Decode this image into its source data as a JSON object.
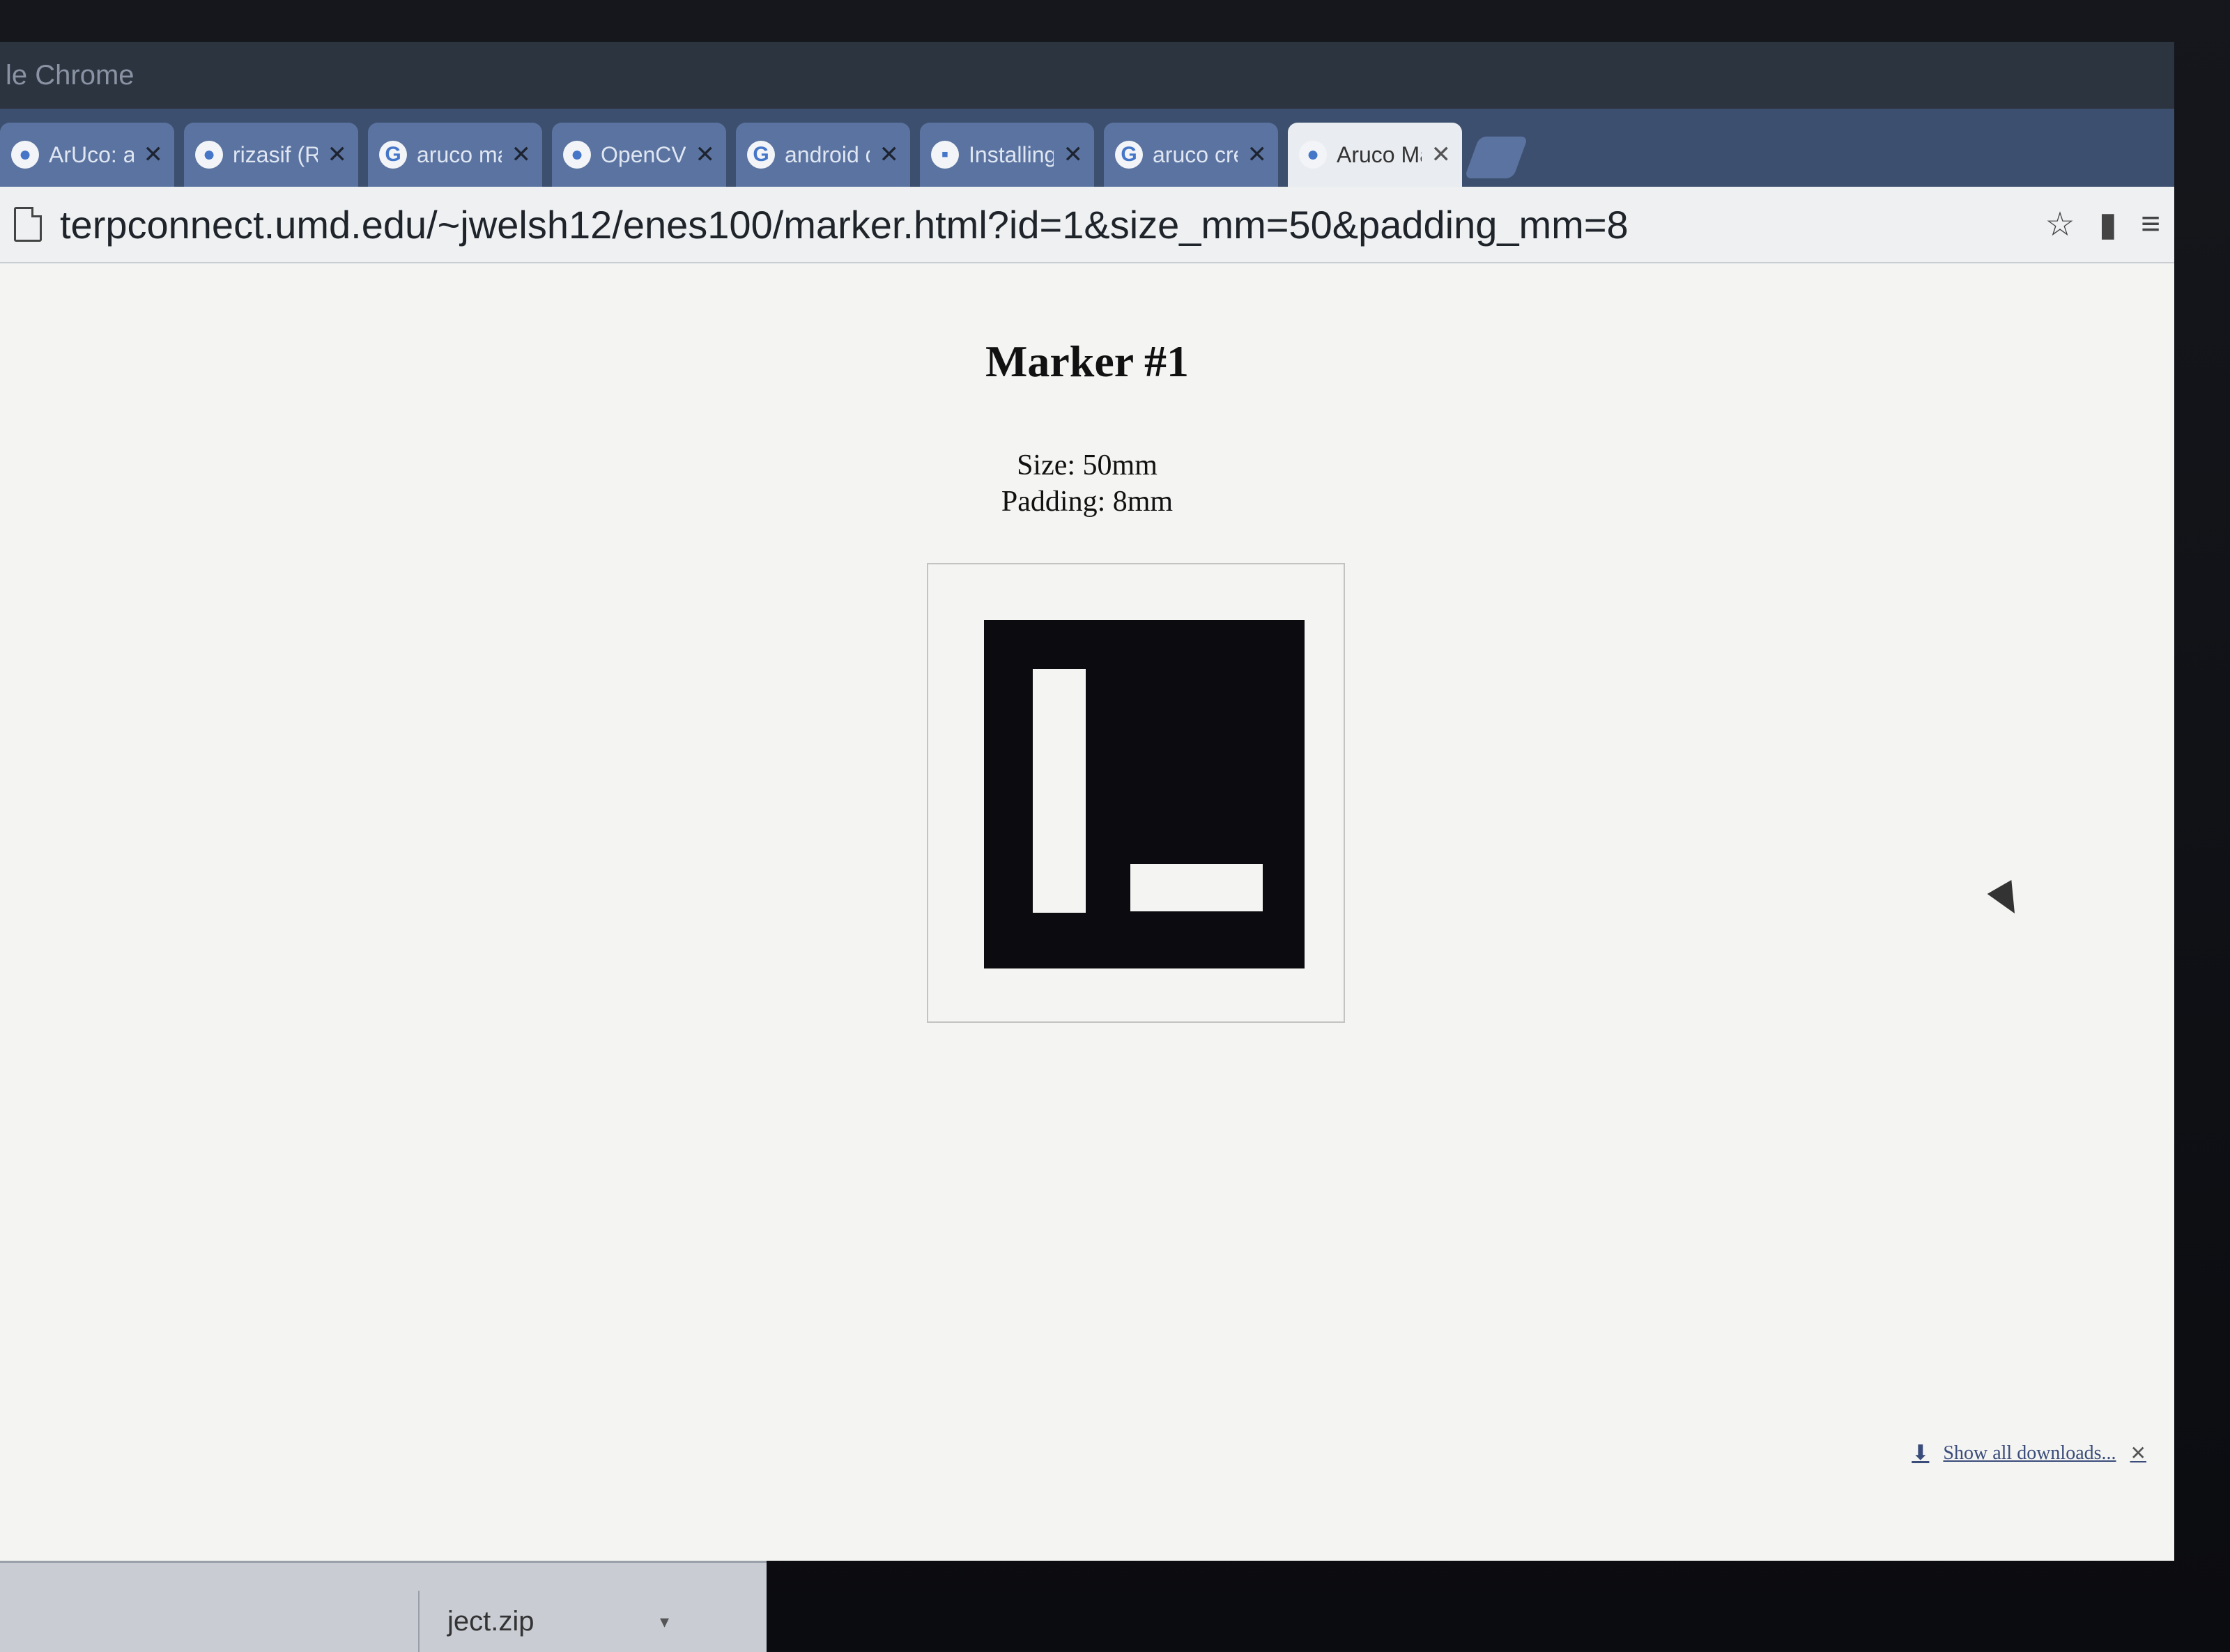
{
  "window": {
    "title": "le Chrome"
  },
  "tabs": [
    {
      "label": "ArUco: a m",
      "favicon": "●",
      "active": false
    },
    {
      "label": "rizasif (Ri",
      "favicon": "●",
      "active": false
    },
    {
      "label": "aruco mar",
      "favicon": "G",
      "active": false
    },
    {
      "label": "OpenCV:",
      "favicon": "●",
      "active": false
    },
    {
      "label": "android dr",
      "favicon": "G",
      "active": false
    },
    {
      "label": "Installing",
      "favicon": "▪",
      "active": false
    },
    {
      "label": "aruco cre",
      "favicon": "G",
      "active": false
    },
    {
      "label": "Aruco Ma",
      "favicon": "●",
      "active": true
    }
  ],
  "toolbar": {
    "url": "terpconnect.umd.edu/~jwelsh12/enes100/marker.html?id=1&size_mm=50&padding_mm=8"
  },
  "page": {
    "title": "Marker #1",
    "size_text": "Size: 50mm",
    "padding_text": "Padding: 8mm"
  },
  "downloads": {
    "show_all": "Show all downloads...",
    "item": "ject.zip"
  },
  "colors": {
    "tab_strip": "#3d4f6e",
    "active_tab": "#e9ecf0",
    "marker": "#0c0c10"
  }
}
